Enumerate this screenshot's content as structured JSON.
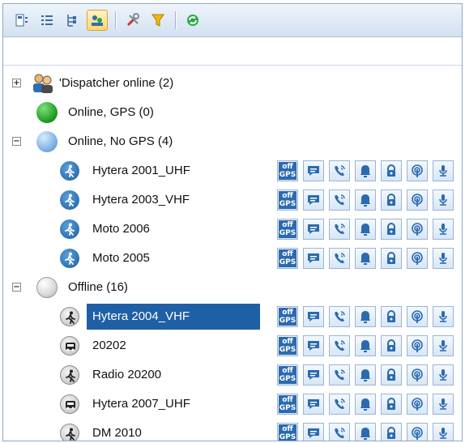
{
  "colors": {
    "accent_blue": "#1f5fa6",
    "online_green": "#1f9c22",
    "online_no_gps_blue": "#7fb3e2",
    "offline_gray": "#c8c8c8",
    "selection": "#1f5fa6"
  },
  "toolbar": {
    "buttons": [
      {
        "icon": "device-info-icon"
      },
      {
        "icon": "list-view-icon"
      },
      {
        "icon": "tree-view-icon"
      },
      {
        "icon": "group-view-icon",
        "active": true
      },
      {
        "icon": "tools-icon"
      },
      {
        "icon": "filter-icon"
      },
      {
        "icon": "refresh-icon"
      }
    ]
  },
  "tree": {
    "dispatcher_group": {
      "label": "'Dispatcher online (2)",
      "icon": "dispatcher-group-icon",
      "expander": "+"
    },
    "online_gps": {
      "label": "Online, GPS (0)",
      "icon": "online-gps-status-icon"
    },
    "online_no_gps": {
      "label": "Online, No GPS (4)",
      "icon": "online-no-gps-status-icon",
      "expander": "−"
    },
    "offline": {
      "label": "Offline (16)",
      "icon": "offline-status-icon",
      "expander": "−"
    },
    "online_devices": [
      {
        "name": "Hytera 2001_UHF",
        "icon": "walking-person-icon"
      },
      {
        "name": "Hytera 2003_VHF",
        "icon": "walking-person-icon"
      },
      {
        "name": "Moto 2006",
        "icon": "walking-person-icon"
      },
      {
        "name": "Moto 2005",
        "icon": "walking-person-icon"
      }
    ],
    "offline_devices": [
      {
        "name": "Hytera 2004_VHF",
        "icon": "walking-person-icon",
        "selected": true
      },
      {
        "name": "20202",
        "icon": "vehicle-icon"
      },
      {
        "name": "Radio 20200",
        "icon": "walking-person-icon"
      },
      {
        "name": "Hytera 2007_UHF",
        "icon": "vehicle-icon"
      },
      {
        "name": "DM 2010",
        "icon": "walking-person-icon"
      }
    ],
    "action_buttons": {
      "gps_line1": "off",
      "gps_line2": "GPS",
      "icons": [
        "message-icon",
        "call-icon",
        "alarm-bell-icon",
        "lock-icon",
        "remote-monitor-icon",
        "microphone-icon"
      ]
    }
  }
}
